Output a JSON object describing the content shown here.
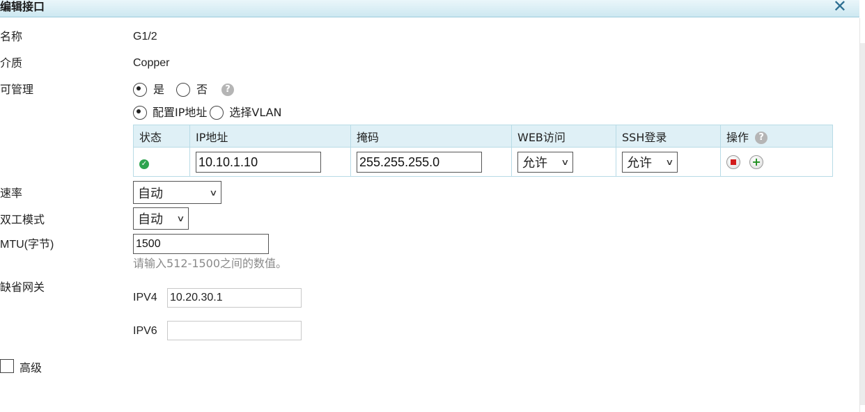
{
  "dialog": {
    "title": "编辑接口",
    "close_glyph": "✕"
  },
  "fields": {
    "name_label": "名称",
    "name_value": "G1/2",
    "medium_label": "介质",
    "medium_value": "Copper",
    "manageable_label": "可管理",
    "manageable_yes": "是",
    "manageable_no": "否",
    "manageable_selected": "是"
  },
  "ip_mode": {
    "config_ip_label": "配置IP地址",
    "select_vlan_label": "选择VLAN",
    "selected": "配置IP地址"
  },
  "ip_table": {
    "headers": [
      "状态",
      "IP地址",
      "掩码",
      "WEB访问",
      "SSH登录",
      "操作"
    ],
    "rows": [
      {
        "status": "ok",
        "ip": "10.10.1.10",
        "mask": "255.255.255.0",
        "web_access": "允许",
        "ssh_login": "允许"
      }
    ]
  },
  "speed": {
    "label": "速率",
    "value": "自动"
  },
  "duplex": {
    "label": "双工模式",
    "value": "自动"
  },
  "mtu": {
    "label": "MTU(字节)",
    "value": "1500",
    "hint": "请输入512-1500之间的数值。"
  },
  "gateway": {
    "label": "缺省网关",
    "ipv4_label": "IPV4",
    "ipv4_value": "10.20.30.1",
    "ipv6_label": "IPV6",
    "ipv6_value": ""
  },
  "advanced": {
    "label": "高级",
    "checked": false
  },
  "colors": {
    "titlebar": "#cde8f1",
    "table_header": "#dff0f6",
    "table_border": "#b8dbe6",
    "close_icon": "#2d6f92",
    "hint_text": "#8a8a8a",
    "status_ok": "#2ea44f",
    "delete_red": "#d21b1b",
    "add_green": "#1f8f1f"
  },
  "icons": {
    "close": "close-icon",
    "help": "help-icon",
    "status": "check-circle-icon",
    "delete": "delete-icon",
    "add": "add-icon",
    "dropdown": "chevron-down-icon"
  }
}
